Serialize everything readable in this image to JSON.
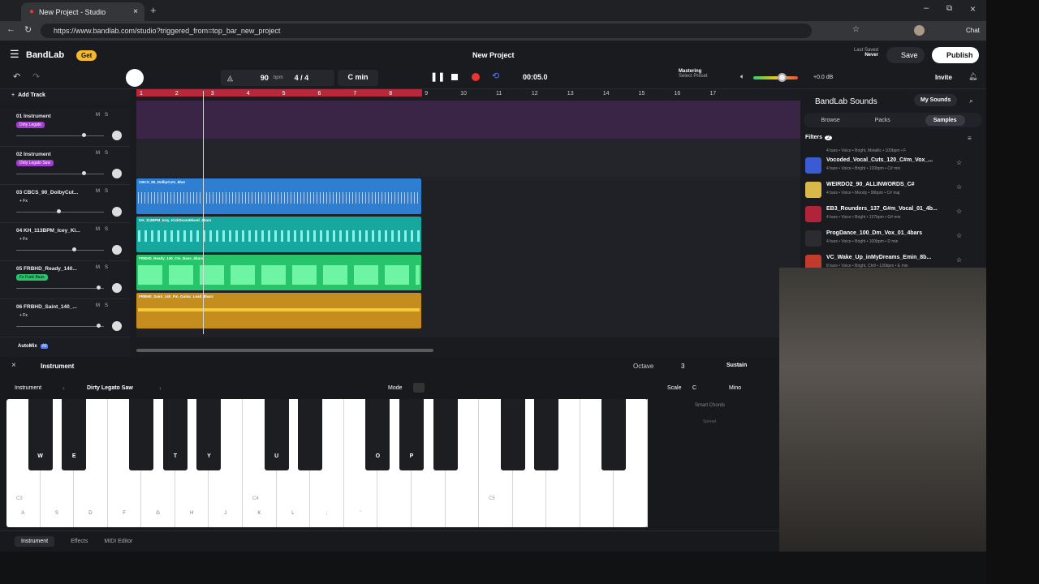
{
  "browser": {
    "tab_title": "New Project - Studio",
    "url": "https://www.bandlab.com/studio?triggered_from=top_bar_new_project",
    "chat_label": "Chat"
  },
  "header": {
    "logo": "BandLab",
    "get_label": "Get",
    "project_title": "New Project",
    "last_saved_label": "Last Saved",
    "last_saved_value": "Never",
    "save_label": "Save",
    "publish_label": "Publish",
    "invite_label": "Invite"
  },
  "transport": {
    "tempo": "90",
    "tempo_unit": "bpm",
    "time_sig": "4 / 4",
    "key": "C min",
    "time": "00:05.0",
    "mastering_label": "Mastering",
    "mastering_sub": "Select Preset",
    "gain": "+0.0 dB"
  },
  "tracks_header": {
    "add_track": "Add Track"
  },
  "tracks": [
    {
      "name": "01 Instrument",
      "sub": "Dirty Legato",
      "color": "#a33dcf"
    },
    {
      "name": "02 Instrument",
      "sub": "Dirty Legato Saw",
      "color": "#a33dcf"
    },
    {
      "name": "03 CBCS_90_DolbyCut...",
      "sub": "+ Fx",
      "color": "#2d87d6"
    },
    {
      "name": "04 KH_113BPM_Icey_Ki...",
      "sub": "+ Fx",
      "color": "#1ab3a8"
    },
    {
      "name": "05 FRBHD_Ready_140...",
      "sub": "Fx Funk Bass",
      "color": "#2ecc71"
    },
    {
      "name": "06 FRBHD_Saint_140_...",
      "sub": "+ Fx",
      "color": "#e6a82b"
    }
  ],
  "ms": {
    "m": "M",
    "s": "S"
  },
  "timeline_ticks": [
    "1",
    "2",
    "3",
    "4",
    "5",
    "6",
    "7",
    "8",
    "9",
    "10",
    "11",
    "12",
    "13",
    "14",
    "15",
    "16",
    "17"
  ],
  "clips": [
    {
      "label": "CBCS_90_DolbyCut1_8bar",
      "color": "#2e7fd1"
    },
    {
      "label": "KH_113BPM_Icey_KickSnareMixed_4bars",
      "color": "#16a89e"
    },
    {
      "label": "FRBHD_Ready_140_Cm_Bass_4bars",
      "color": "#27c46a"
    },
    {
      "label": "FRBHD_Saint_140_Fm_Guitar_Lead_8bars",
      "color": "#c48d1d"
    }
  ],
  "automix": {
    "label": "AutoMix",
    "badge": "AI"
  },
  "sounds": {
    "brand": "BandLab Sounds",
    "my_sounds": "My Sounds",
    "tabs": [
      "Browse",
      "Packs",
      "Samples"
    ],
    "filters_label": "Filters",
    "filters_count": "2",
    "top_meta": "4 bars • Voice • Bright, Metallic • 100bpm • F",
    "items": [
      {
        "title": "Vocoded_Vocal_Cuts_120_C#m_Vox_...",
        "meta": "4 bars • Voice • Bright • 120bpm • C# min",
        "color": "#3a5bd1"
      },
      {
        "title": "WEIRDO2_90_ALLINWORDS_C#",
        "meta": "4 bars • Voice • Moody • 90bpm • C# maj",
        "color": "#d9b84a"
      },
      {
        "title": "EB3_Rounders_137_G#m_Vocal_01_4b...",
        "meta": "4 bars • Voice • Bright • 137bpm • G# min",
        "color": "#b0233a"
      },
      {
        "title": "ProgDance_100_Dm_Vox_01_4bars",
        "meta": "4 bars • Voice • Bright • 100bpm • D min",
        "color": "#2b2b30"
      },
      {
        "title": "VC_Wake_Up_inMyDreams_Emin_8b...",
        "meta": "8 bars • Voice • Bright, Chill • 130bpm • E min",
        "color": "#c23a2b"
      }
    ]
  },
  "instrument_panel": {
    "title": "Instrument",
    "instrument_label": "Instrument",
    "preset": "Dirty Legato Saw",
    "mode_label": "Mode",
    "octave_label": "Octave",
    "octave_value": "3",
    "sustain_label": "Sustain",
    "scale_label": "Scale",
    "scale_value": "C",
    "scale_mode": "Mino",
    "smart_chords": "Smart Chords",
    "spread": "Spread"
  },
  "keyboard": {
    "white_keys": [
      "A",
      "S",
      "D",
      "F",
      "G",
      "H",
      "J",
      "K",
      "L",
      ";",
      "'",
      "",
      "",
      "",
      "",
      "",
      "",
      "",
      ""
    ],
    "black_keys": [
      "W",
      "E",
      "",
      "T",
      "Y",
      "U",
      "",
      "O",
      "P",
      "",
      "",
      "",
      "",
      "",
      "",
      ""
    ],
    "notes": [
      "C3",
      "C4",
      "C5"
    ]
  },
  "bottom_tabs": [
    "Instrument",
    "Effects",
    "MIDI Editor"
  ]
}
